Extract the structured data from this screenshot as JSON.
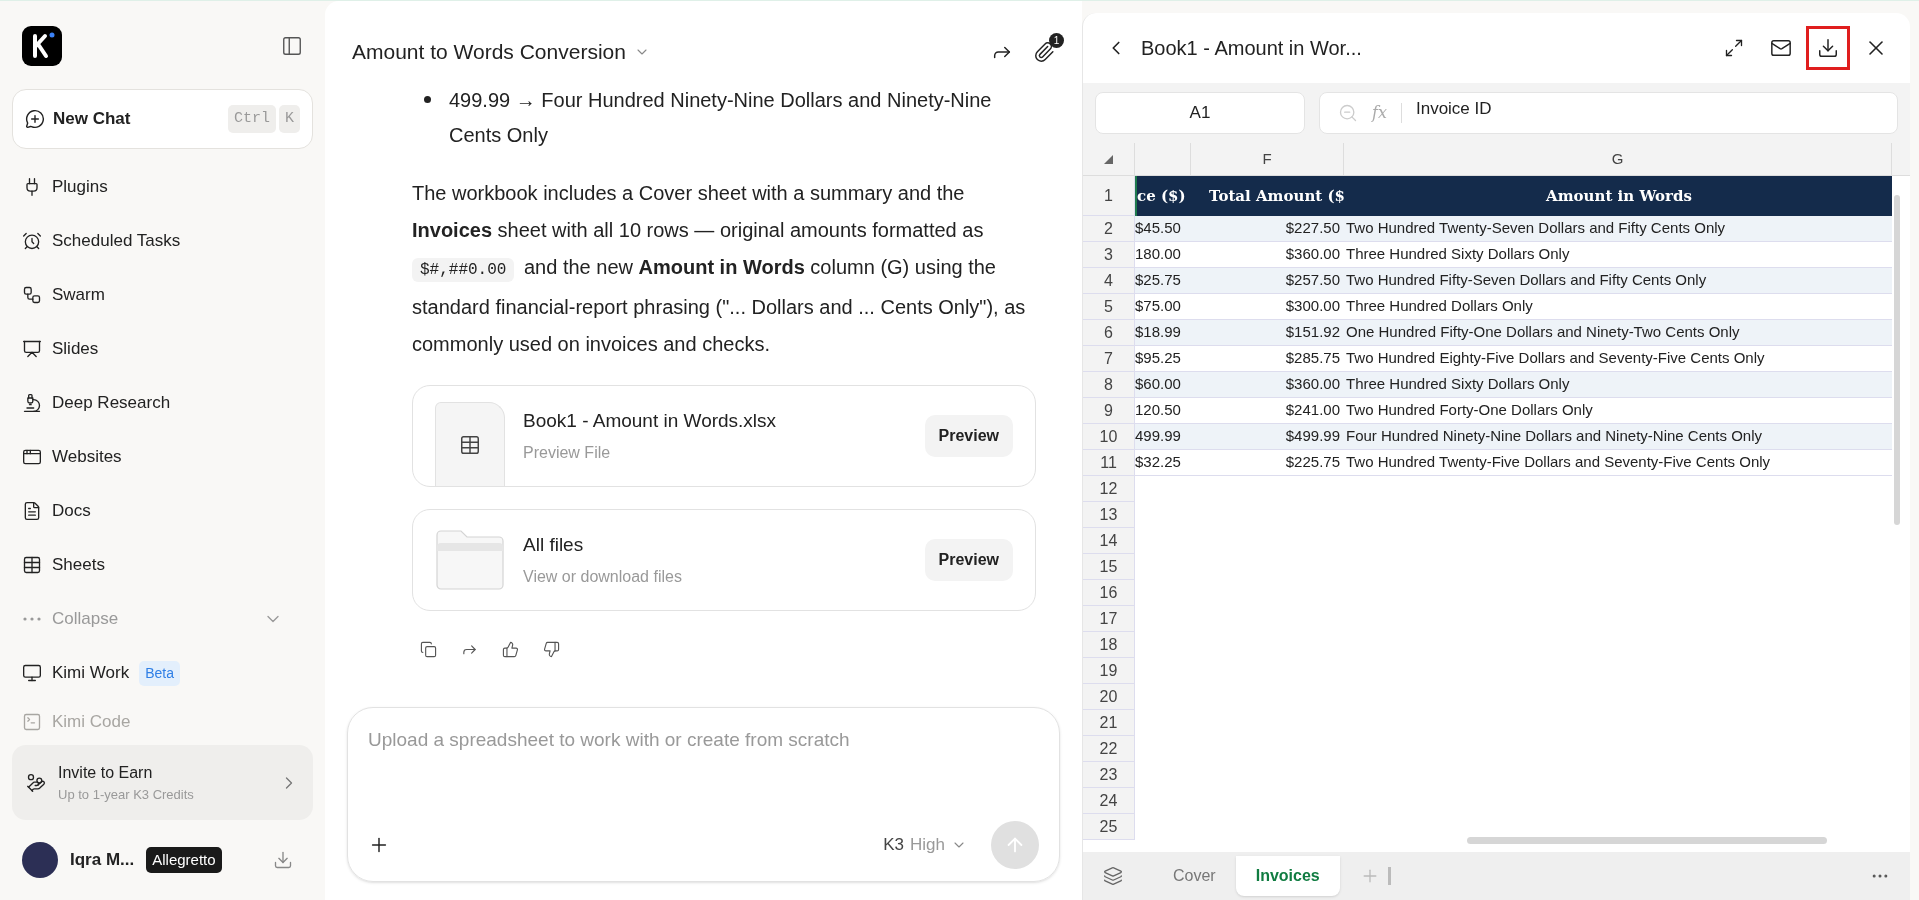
{
  "sidebar": {
    "new_chat": {
      "label": "New Chat",
      "shortcut": [
        "Ctrl",
        "K"
      ]
    },
    "items": [
      {
        "label": "Plugins"
      },
      {
        "label": "Scheduled Tasks"
      },
      {
        "label": "Swarm"
      },
      {
        "label": "Slides"
      },
      {
        "label": "Deep Research"
      },
      {
        "label": "Websites"
      },
      {
        "label": "Docs"
      },
      {
        "label": "Sheets"
      }
    ],
    "collapse": {
      "label": "Collapse"
    },
    "work_items": [
      {
        "label": "Kimi Work",
        "badge": "Beta",
        "faded": false
      },
      {
        "label": "Kimi Code",
        "faded": true
      }
    ],
    "invite": {
      "title": "Invite to Earn",
      "subtitle": "Up to 1-year K3 Credits"
    },
    "user": {
      "name": "Iqra M...",
      "plan": "Allegretto"
    }
  },
  "chat": {
    "title": "Amount to Words Conversion",
    "attachment_count": "1",
    "bullet": "499.99 → Four Hundred Ninety-Nine Dollars and Ninety-Nine Cents Only",
    "paragraph": [
      {
        "kind": "text",
        "text": "The workbook includes a Cover sheet with a summary and the **Invoices** sheet with all 10 rows — original amounts formatted as "
      },
      {
        "kind": "code",
        "text": "$#,##0.00"
      },
      {
        "kind": "text",
        "text": " and the new **Amount in Words** column (G) using the standard financial-report phrasing (\"... Dollars and ... Cents Only\"), as commonly used on invoices and checks."
      }
    ],
    "files": [
      {
        "kind": "sheet",
        "name": "Book1 - Amount in Words.xlsx",
        "subtitle": "Preview File",
        "button": "Preview"
      },
      {
        "kind": "folder",
        "name": "All files",
        "subtitle": "View or download files",
        "button": "Preview"
      }
    ],
    "input": {
      "placeholder": "Upload a spreadsheet to work with or create from scratch",
      "model": "K3",
      "effort": "High"
    }
  },
  "viewer": {
    "title": "Book1 - Amount in Wor...",
    "download_highlighted": true,
    "cell_ref": "A1",
    "function_label": "fx",
    "formula": "Invoice ID",
    "columns": [
      "",
      "F",
      "G"
    ],
    "header_row": {
      "number": "1",
      "cells": [
        "ce ($)",
        "Total Amount ($",
        "Amount in Words"
      ]
    },
    "rows": [
      {
        "number": "2",
        "cells": [
          "$45.50",
          "$227.50",
          "Two Hundred Twenty-Seven Dollars and Fifty Cents Only"
        ]
      },
      {
        "number": "3",
        "cells": [
          "180.00",
          "$360.00",
          "Three Hundred Sixty Dollars Only"
        ]
      },
      {
        "number": "4",
        "cells": [
          "$25.75",
          "$257.50",
          "Two Hundred Fifty-Seven Dollars and Fifty Cents Only"
        ]
      },
      {
        "number": "5",
        "cells": [
          "$75.00",
          "$300.00",
          "Three Hundred Dollars Only"
        ]
      },
      {
        "number": "6",
        "cells": [
          "$18.99",
          "$151.92",
          "One Hundred Fifty-One Dollars and Ninety-Two Cents Only"
        ]
      },
      {
        "number": "7",
        "cells": [
          "$95.25",
          "$285.75",
          "Two Hundred Eighty-Five Dollars and Seventy-Five Cents Only"
        ]
      },
      {
        "number": "8",
        "cells": [
          "$60.00",
          "$360.00",
          "Three Hundred Sixty Dollars Only"
        ]
      },
      {
        "number": "9",
        "cells": [
          "120.50",
          "$241.00",
          "Two Hundred Forty-One Dollars Only"
        ]
      },
      {
        "number": "10",
        "cells": [
          "499.99",
          "$499.99",
          "Four Hundred Ninety-Nine Dollars and Ninety-Nine Cents Only"
        ]
      },
      {
        "number": "11",
        "cells": [
          "$32.25",
          "$225.75",
          "Two Hundred Twenty-Five Dollars and Seventy-Five Cents Only"
        ]
      }
    ],
    "empty_rows": [
      "12",
      "13",
      "14",
      "15",
      "16",
      "17",
      "18",
      "19",
      "20",
      "21",
      "22",
      "23",
      "24",
      "25"
    ],
    "tabs": [
      {
        "label": "Cover",
        "selected": false
      },
      {
        "label": "Invoices",
        "selected": true
      }
    ]
  }
}
